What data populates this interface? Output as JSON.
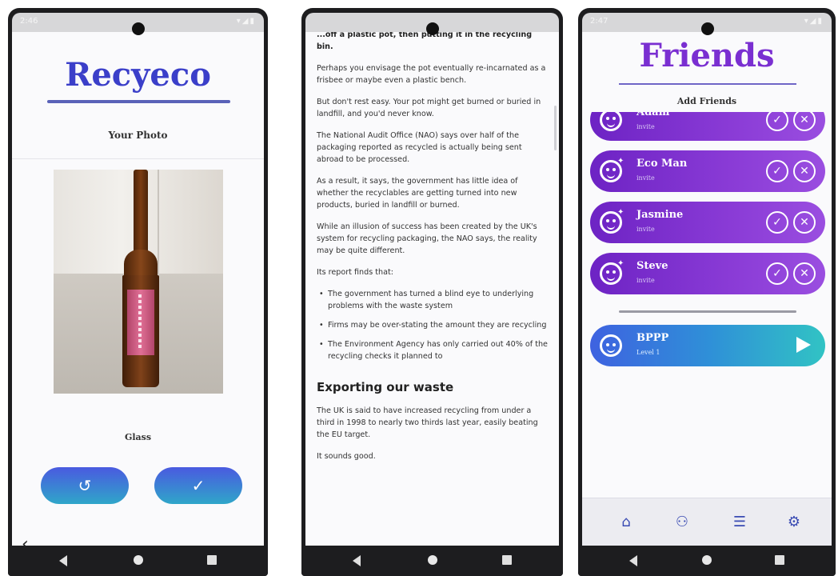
{
  "colors": {
    "brand_blue": "#3b3fc9",
    "button_gradient_top": "#4a5ae0",
    "button_gradient_bottom": "#2fa6c9",
    "friend_card_purple": "#7a2fd1",
    "friends_title": "#7a2fd1",
    "me_card_blue": "#3e62e0",
    "me_card_teal": "#31c3c4",
    "nav_icon": "#3a4bb3"
  },
  "phone1": {
    "status": {
      "time": "2:46"
    },
    "app_title": "Recyeco",
    "section_label": "Your Photo",
    "material_label": "Glass",
    "buttons": {
      "retake_icon": "↺",
      "confirm_icon": "✓"
    },
    "back_icon": "‹"
  },
  "phone2": {
    "lead": "...off a plastic pot, then putting it in the recycling bin.",
    "paragraphs": [
      "Perhaps you envisage the pot eventually re-incarnated as a frisbee or maybe even a plastic bench.",
      "But don't rest easy. Your pot might get burned or buried in landfill, and you'd never know.",
      "The National Audit Office (NAO) says over half of the packaging reported as recycled is actually being sent abroad to be processed.",
      "As a result, it says, the government has little idea of whether the recyclables are getting turned into new products, buried in landfill or burned.",
      "While an illusion of success has been created by the UK's system for recycling packaging, the NAO says, the reality may be quite different.",
      "Its report finds that:"
    ],
    "bullets": [
      "The government has turned a blind eye to underlying problems with the waste system",
      "Firms may be over-stating the amount they are recycling",
      "The Environment Agency has only carried out 40% of the recycling checks it planned to"
    ],
    "heading": "Exporting our waste",
    "after_heading": [
      "The UK is said to have increased recycling from under a third in 1998 to nearly two thirds last year, easily beating the EU target.",
      "It sounds good."
    ]
  },
  "phone3": {
    "status": {
      "time": "2:47"
    },
    "title": "Friends",
    "subtitle": "Add Friends",
    "requests": [
      {
        "name": "Adam",
        "action": "invite"
      },
      {
        "name": "Eco Man",
        "action": "invite"
      },
      {
        "name": "Jasmine",
        "action": "invite"
      },
      {
        "name": "Steve",
        "action": "invite"
      }
    ],
    "accept_icon": "✓",
    "decline_icon": "✕",
    "me": {
      "name": "BPPP",
      "level": "Level 1"
    },
    "tabs": [
      {
        "name": "home",
        "icon": "⌂"
      },
      {
        "name": "friends",
        "icon": "⚇"
      },
      {
        "name": "list",
        "icon": "☰"
      },
      {
        "name": "settings",
        "icon": "⚙"
      }
    ]
  }
}
